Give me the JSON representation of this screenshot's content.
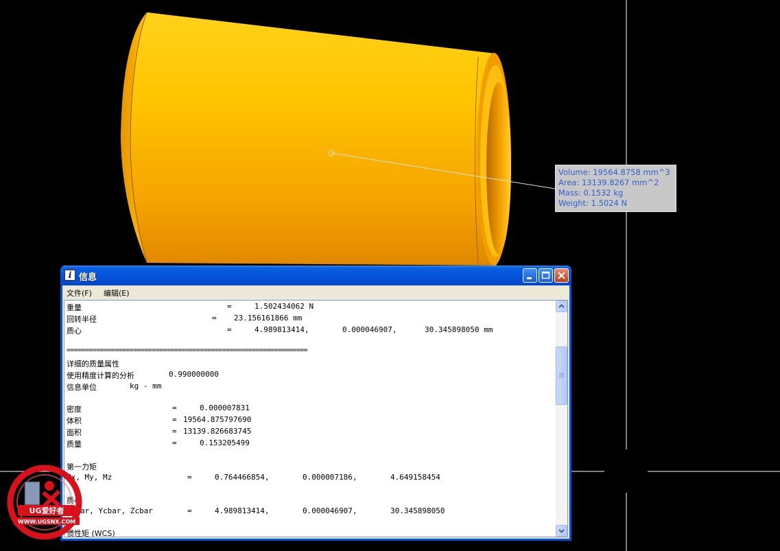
{
  "tooltip": {
    "volume": "Volume: 19564.8758 mm^3",
    "area": "Area: 13139.8267 mm^2",
    "mass": "Mass: 0.1532 kg",
    "weight": "Weight: 1.5024 N"
  },
  "window": {
    "title": "信息",
    "icon": "info-icon",
    "menu": {
      "file": "文件(F)",
      "edit": "编辑(E)"
    }
  },
  "info": {
    "weight_label": "重量",
    "eq": "=",
    "weight_value": "1.502434062 N",
    "gyration_label": "回转半径",
    "gyration_value": "23.156161866 mm",
    "centroid_label": "质心",
    "centroid_x": "4.989813414,",
    "centroid_y": "0.000046907,",
    "centroid_z": "30.345898050 mm",
    "separator": "=================================================================",
    "detail_title": "详细的质量属性",
    "accuracy_label": "使用精度计算的分析",
    "accuracy_value": "0.990000000",
    "units_label": "信息单位",
    "units_value": "kg - mm",
    "density_label": "密度",
    "density_value": "0.000007831",
    "volume_label": "体积",
    "volume_value": "19564.875797690",
    "area_label": "面积",
    "area_value": "13139.826683745",
    "mass_label": "质量",
    "mass_value": "0.153205499",
    "first_moment_title": "第一力矩",
    "moments_label": "Mx, My, Mz",
    "mx": "0.764466854,",
    "my": "0.000007186,",
    "mz": "4.649158454",
    "centroid2_title": "质心",
    "cbar_label": "Xcbar, Ycbar, Zcbar",
    "xcbar": "4.989813414,",
    "ycbar": "0.000046907,",
    "zcbar": "30.345898050",
    "last_partial": "惯性矩 (WCS)"
  },
  "watermark": {
    "brand": "UG爱好者",
    "url": "WWW.UGSNX.COM"
  },
  "colors": {
    "part": "#ffb300",
    "tooltip_text": "#2f5fd0",
    "titlebar": "#0452d9",
    "logo": "#d8111a"
  }
}
